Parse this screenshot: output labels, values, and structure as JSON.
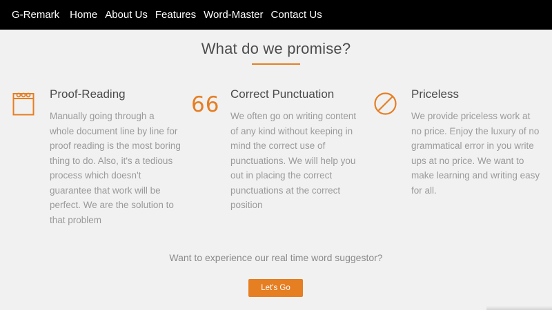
{
  "nav": {
    "brand": "G-Remark",
    "links": [
      "Home",
      "About Us",
      "Features",
      "Word-Master",
      "Contact Us"
    ]
  },
  "section": {
    "title": "What do we promise?"
  },
  "features": [
    {
      "icon": "notepad-icon",
      "title": "Proof-Reading",
      "lines": [
        "Manually going through a",
        "whole document line by line for",
        "proof reading is the most boring",
        "thing to do. Also, it's a tedious",
        "process which doesn't",
        "guarantee that work will be",
        "perfect. We are the solution to",
        "that problem"
      ]
    },
    {
      "icon": "quote-icon",
      "icon_text": "66",
      "title": "Correct Punctuation",
      "lines": [
        "We often go on writing content",
        "of any kind without keeping in",
        "mind the correct use of",
        "punctuations. We will help you",
        "out in placing the correct",
        "punctuations at the correct",
        "position"
      ]
    },
    {
      "icon": "ban-icon",
      "title": "Priceless",
      "lines": [
        "We provide priceless work at",
        "no price. Enjoy the luxury of no",
        "grammatical error in you write",
        "ups at no price. We want to",
        "make learning and writing easy",
        "for all."
      ]
    }
  ],
  "cta": {
    "text": "Want to experience our real time word suggestor?",
    "button": "Let's Go"
  },
  "colors": {
    "accent": "#e67e22",
    "navbar": "#000000",
    "background": "#f1f1f1"
  }
}
